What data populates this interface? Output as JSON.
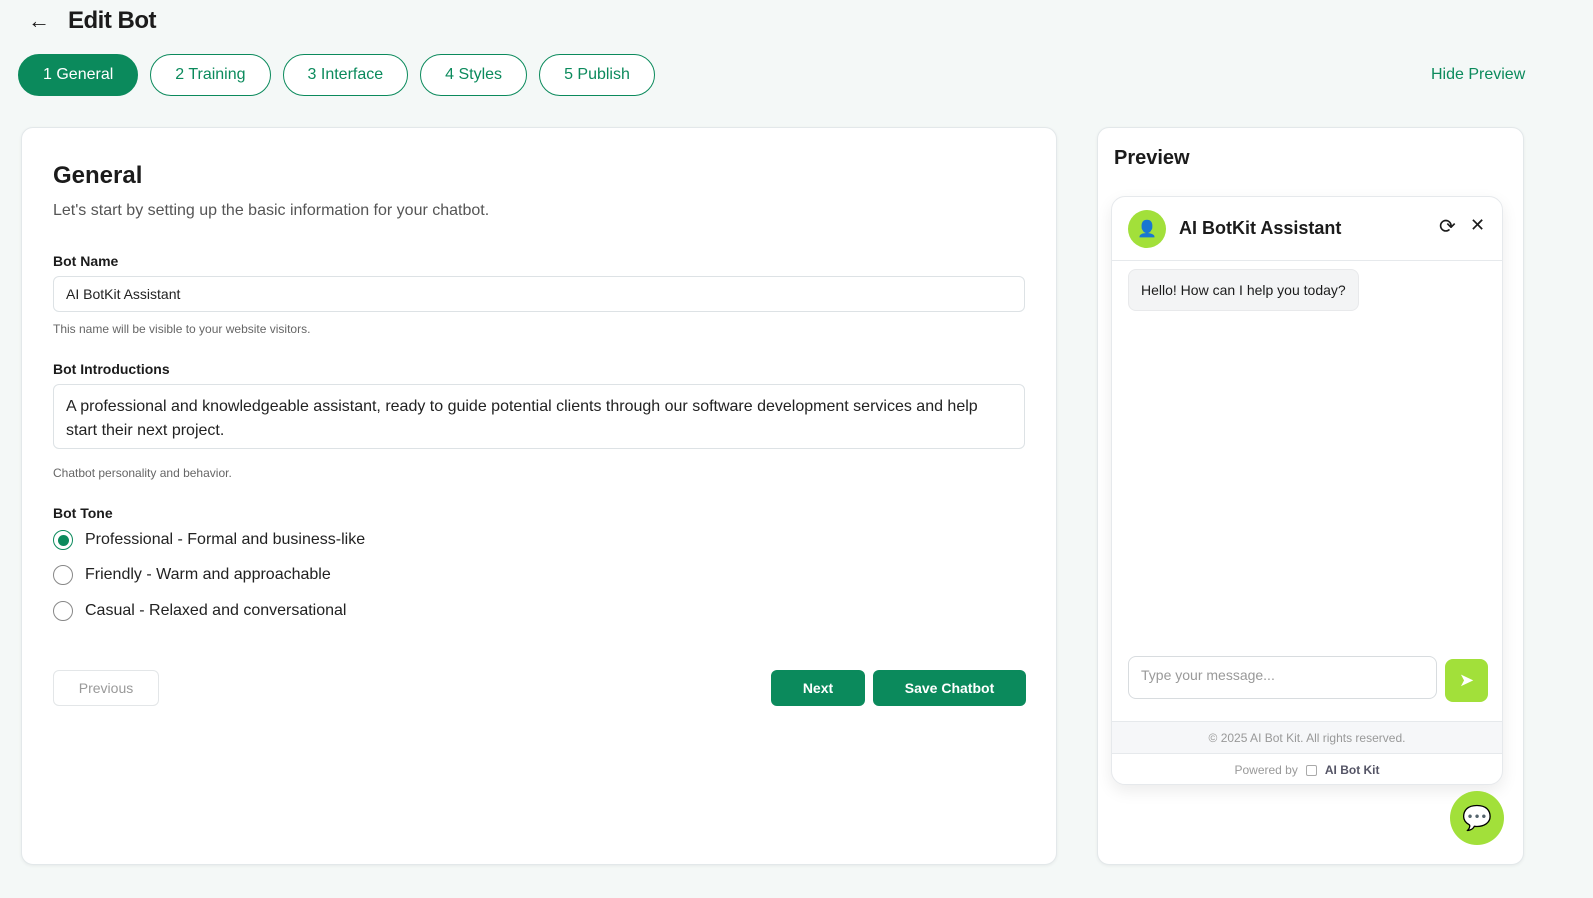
{
  "header": {
    "title": "Edit Bot",
    "hide_preview": "Hide Preview"
  },
  "tabs": [
    {
      "label": "1 General"
    },
    {
      "label": "2 Training"
    },
    {
      "label": "3 Interface"
    },
    {
      "label": "4 Styles"
    },
    {
      "label": "5 Publish"
    }
  ],
  "general": {
    "title": "General",
    "subtitle": "Let's start by setting up the basic information for your chatbot.",
    "bot_name_label": "Bot Name",
    "bot_name_value": "AI BotKit Assistant",
    "bot_name_help": "This name will be visible to your website visitors.",
    "intro_label": "Bot Introductions",
    "intro_value": "A professional and knowledgeable assistant, ready to guide potential clients through our software development services and help start their next project.",
    "intro_help": "Chatbot personality and behavior.",
    "tone_label": "Bot Tone",
    "tones": [
      "Professional - Formal and business-like",
      "Friendly - Warm and approachable",
      "Casual - Relaxed and conversational"
    ],
    "previous": "Previous",
    "next": "Next",
    "save": "Save Chatbot"
  },
  "preview": {
    "title": "Preview",
    "bot_name": "AI BotKit Assistant",
    "greeting": "Hello! How can I help you today?",
    "input_placeholder": "Type your message...",
    "copyright": "© 2025 AI Bot Kit. All rights reserved.",
    "powered_by": "Powered by",
    "brand": "AI Bot Kit"
  },
  "colors": {
    "primary": "#0b8a5c",
    "accent": "#a2e03a"
  }
}
